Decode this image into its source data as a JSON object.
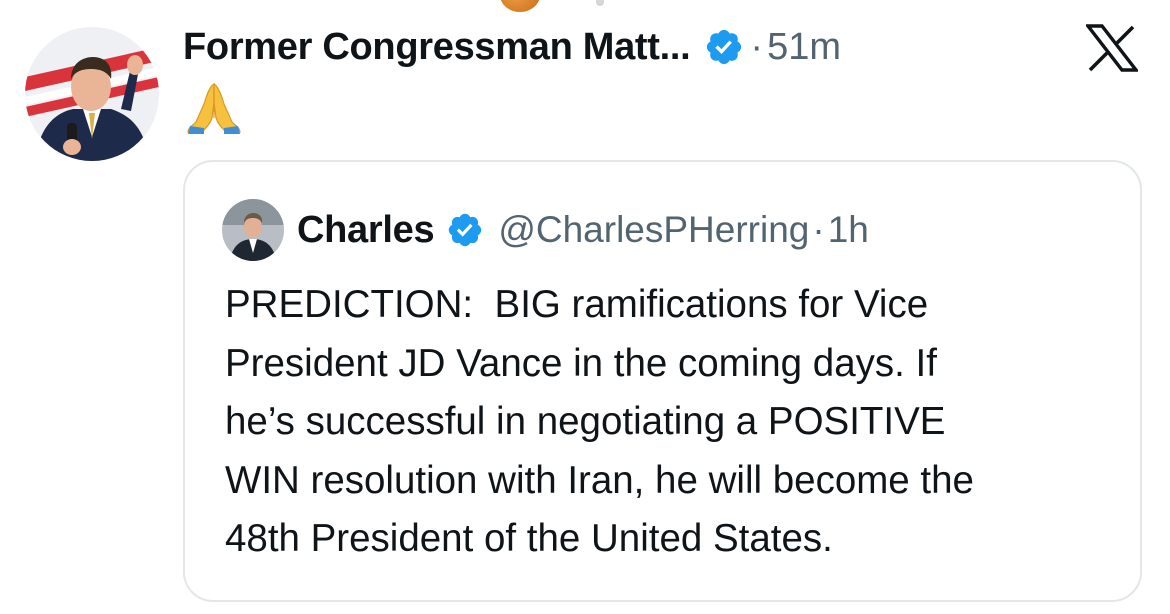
{
  "tweet": {
    "author_name": "Former Congressman Matt...",
    "separator": "·",
    "time": "51m",
    "emoji_name": "folded-hands-emoji"
  },
  "quoted_tweet": {
    "author_name": "Charles",
    "handle": "@CharlesPHerring",
    "separator": "·",
    "time": "1h",
    "text_lines": [
      "PREDICTION:  BIG ramifications for Vice",
      "President JD Vance in the coming days. If",
      "he’s successful in negotiating a POSITIVE",
      "WIN resolution with Iran, he will become the",
      "48th President of the United States."
    ]
  },
  "colors": {
    "verified_blue": "#1d9bf0",
    "secondary_text": "#536471",
    "card_border": "#e3e7ea"
  },
  "icons": [
    "verified-badge-icon",
    "x-logo-icon",
    "folded-hands-emoji"
  ]
}
